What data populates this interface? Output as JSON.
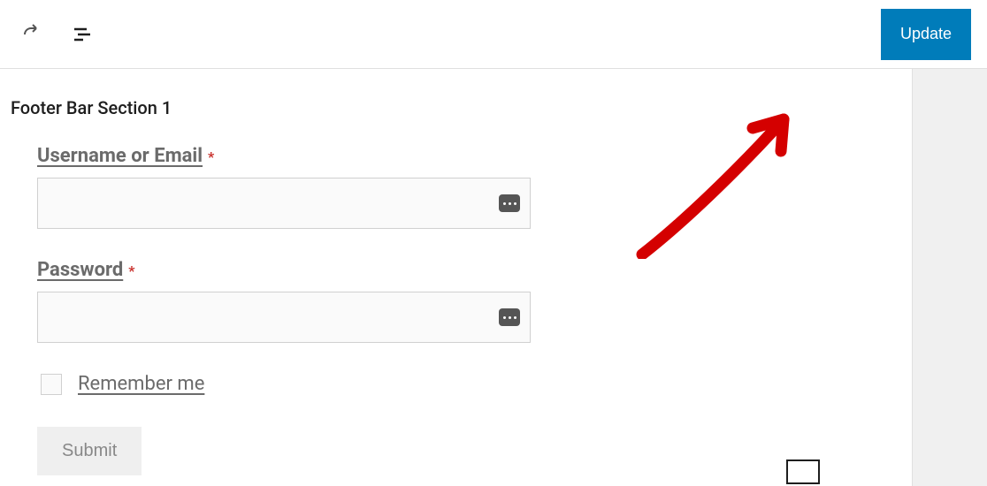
{
  "topbar": {
    "update_label": "Update"
  },
  "section": {
    "title": "Footer Bar Section 1"
  },
  "form": {
    "username": {
      "label": "Username or Email",
      "required": "*",
      "value": ""
    },
    "password": {
      "label": "Password",
      "required": "*",
      "value": ""
    },
    "remember": {
      "label": "Remember me"
    },
    "submit_label": "Submit"
  }
}
